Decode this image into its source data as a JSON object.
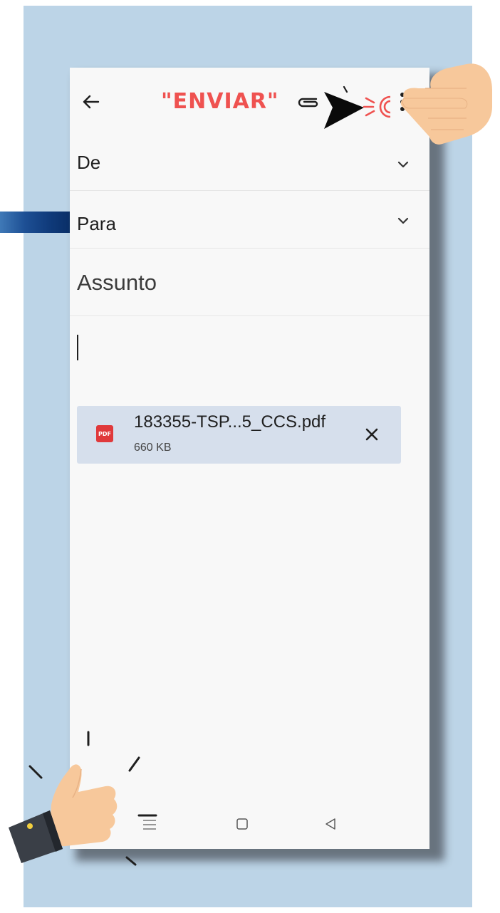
{
  "header": {
    "banner_text": "\"ENVIAR\"",
    "icons": [
      "back-arrow-icon",
      "paperclip-icon",
      "send-icon",
      "more-vert-icon"
    ],
    "banner_color": "#ef5250"
  },
  "compose": {
    "from_label": "De",
    "to_label": "Para",
    "subject_placeholder": "Assunto",
    "body_value": ""
  },
  "attachment": {
    "type_badge": "PDF",
    "filename": "183355-TSP...5_CCS.pdf",
    "size": "660 KB"
  },
  "navbar": {
    "icons": [
      "menu-icon",
      "home-icon",
      "back-icon"
    ]
  },
  "colors": {
    "background_panel": "#bcd4e7",
    "attachment_bg": "#d6dfec",
    "pdf_red": "#e0393b",
    "hand_skin": "#f7c89b"
  }
}
